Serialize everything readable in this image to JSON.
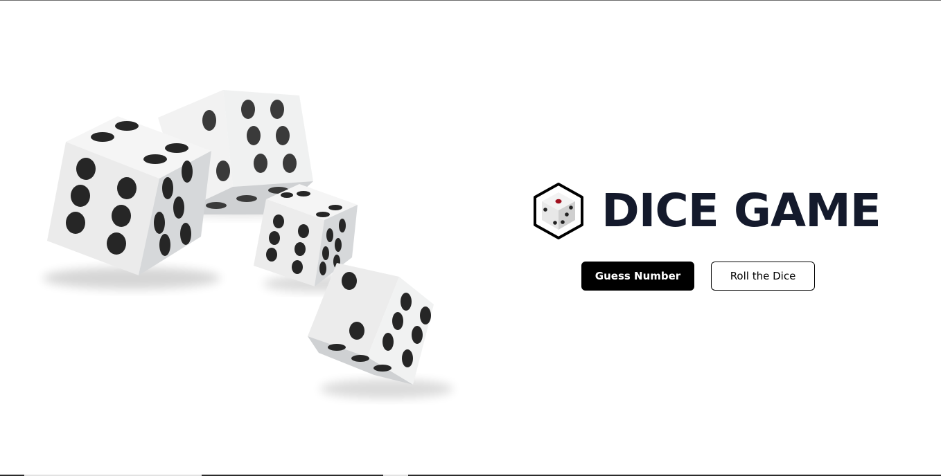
{
  "app": {
    "title": "DICE GAME",
    "logo_icon": "dice-cube-icon",
    "hero_image": "dice-illustration"
  },
  "actions": {
    "guess_label": "Guess Number",
    "roll_label": "Roll the Dice"
  },
  "colors": {
    "title": "#141a2c",
    "primary_button_bg": "#000000",
    "primary_button_text": "#ffffff",
    "secondary_button_bg": "#ffffff",
    "pip": "#2a2a2a",
    "logo_pip_accent": "#a0101e"
  }
}
